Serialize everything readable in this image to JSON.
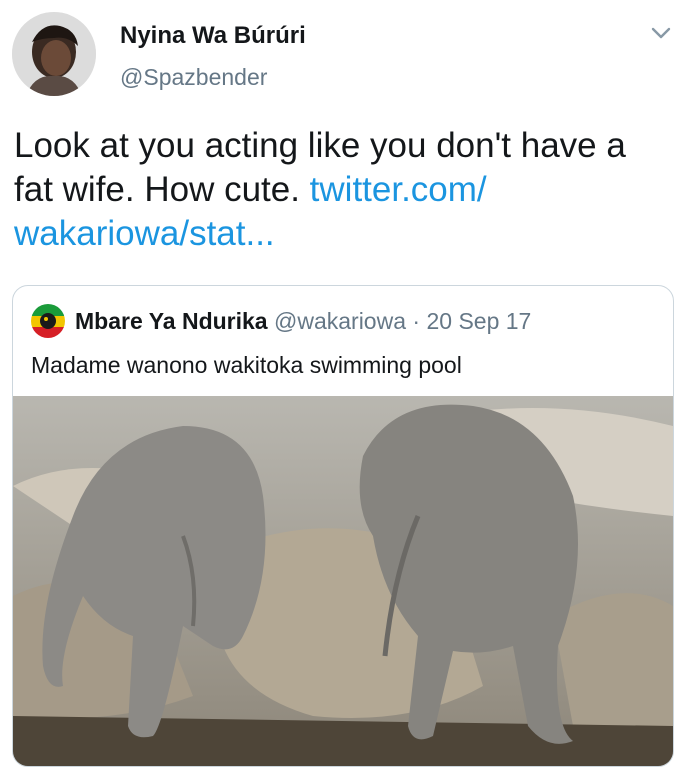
{
  "author": {
    "display_name": "Nyina Wa Búrúri",
    "handle": "@Spazbender",
    "avatar_icon": "profile-photo"
  },
  "menu_icon": "chevron-down-icon",
  "tweet": {
    "text_lead": "Look at you acting like you don't have a fat wife. How cute. ",
    "link_text": "twitter.com/ wakariowa/stat..."
  },
  "quoted_tweet": {
    "display_name": "Mbare Ya Ndurika",
    "handle": "@wakariowa",
    "separator": " · ",
    "date": "20 Sep 17",
    "text": "Madame wanono wakitoka swimming pool",
    "avatar_icon": "rasta-flag-avatar",
    "media": "photo of two baby elephants climbing over rocks"
  },
  "colors": {
    "link": "#1b95e0",
    "secondary_text": "#657786",
    "border": "#ccd6dd"
  }
}
